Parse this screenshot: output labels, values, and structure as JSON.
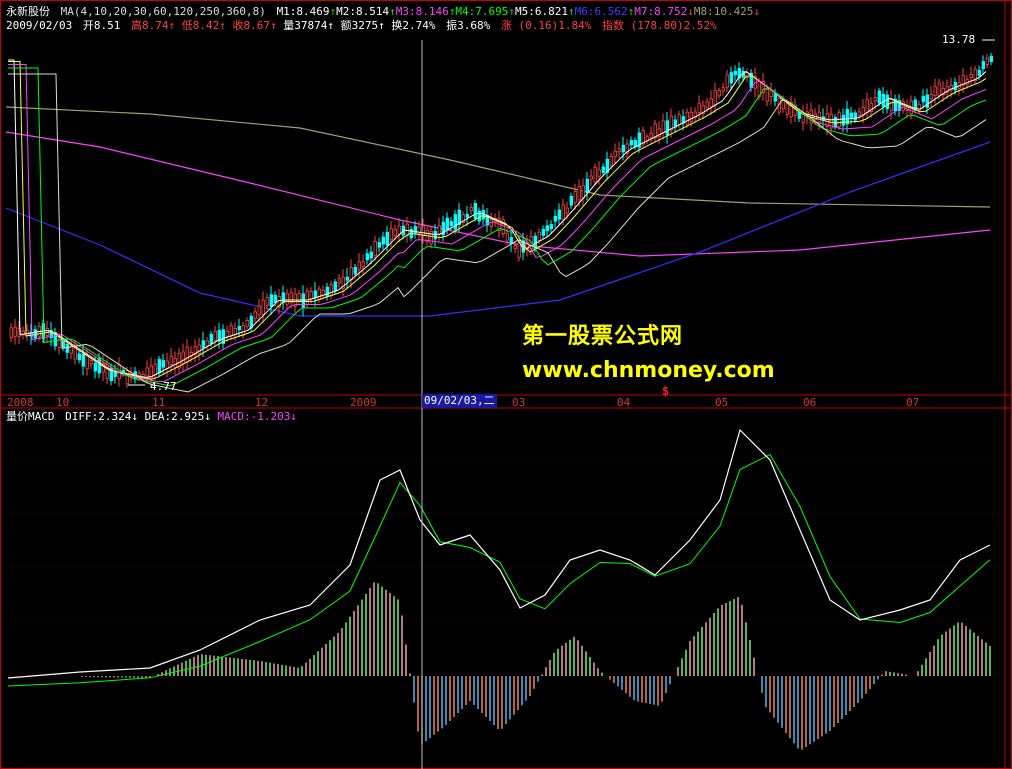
{
  "header": {
    "stock_name": "永新股份",
    "ma_label": "MA(4,10,20,30,60,120,250,360,8)",
    "ma_values": [
      {
        "label": "M1:8.469",
        "color": "#ffffff",
        "arrow": "up"
      },
      {
        "label": "M2:8.514",
        "color": "#ffffff",
        "arrow": "up"
      },
      {
        "label": "M3:8.146",
        "color": "#ff40ff",
        "arrow": "up"
      },
      {
        "label": "M4:7.695",
        "color": "#00ff00",
        "arrow": "up"
      },
      {
        "label": "M5:6.821",
        "color": "#ffffff",
        "arrow": "up"
      },
      {
        "label": "M6:6.562",
        "color": "#4040ff",
        "arrow": "up"
      },
      {
        "label": "M7:8.752",
        "color": "#ff40ff",
        "arrow": "down"
      },
      {
        "label": "M8:10.425",
        "color": "#a0a070",
        "arrow": "down"
      }
    ]
  },
  "quote": {
    "date": "2009/02/03",
    "open": "开8.51",
    "high": "高8.74",
    "low": "低8.42",
    "close": "收8.67",
    "volume": "量37874",
    "amount": "额3275",
    "turnover": "换2.74%",
    "amplitude": "振3.68%",
    "change": "涨 (0.16)1.84%",
    "index": "指数 (178.80)2.52%"
  },
  "price_labels": {
    "high_mark": "13.78",
    "low_mark": "4.77"
  },
  "date_axis": {
    "labels": [
      "2008",
      "10",
      "11",
      "12",
      "2009",
      "03",
      "04",
      "05",
      "06",
      "07"
    ],
    "cursor_date": "09/02/03,二",
    "marker": "$"
  },
  "macd_header": {
    "title": "量价MACD",
    "diff": "DIFF:2.324",
    "dea": "DEA:2.925",
    "macd": "MACD:-1.203"
  },
  "watermark": {
    "line1": "第一股票公式网",
    "line2": "www.chnmoney.com"
  },
  "colors": {
    "frame": "#c80000",
    "up": "#ff4040",
    "down": "#00ffff",
    "diff": "#ffffff",
    "dea": "#00ff00"
  }
}
